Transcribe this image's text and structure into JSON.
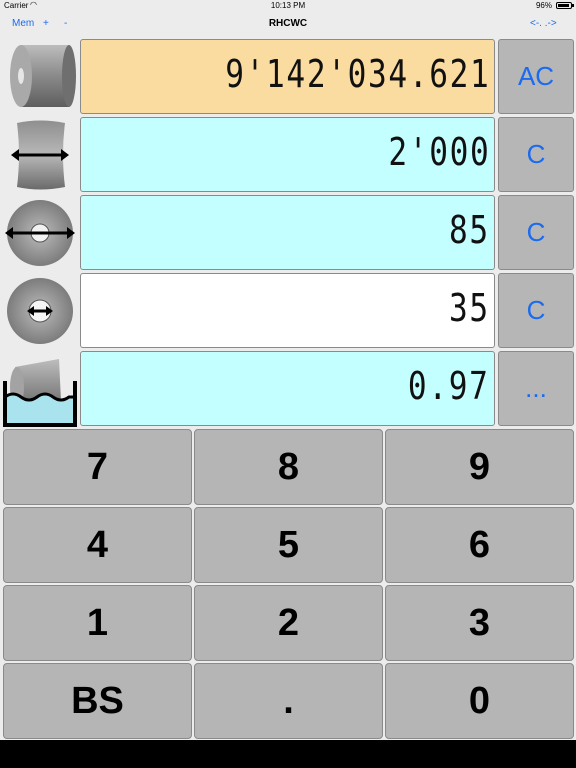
{
  "status_bar": {
    "carrier": "Carrier",
    "time": "10:13 PM",
    "battery": "96%"
  },
  "nav": {
    "mem": "Mem",
    "plus": "+",
    "minus": "-",
    "title": "RHCWC",
    "arrows": "<-. .->"
  },
  "rows": [
    {
      "icon": "roll-side-icon",
      "value": "9'142'034.621",
      "button": "AC",
      "bg": "#fadba0"
    },
    {
      "icon": "roll-width-icon",
      "value": "2'000",
      "button": "C",
      "bg": "#c4ffff"
    },
    {
      "icon": "outer-diameter-icon",
      "value": "85",
      "button": "C",
      "bg": "#c4ffff"
    },
    {
      "icon": "core-diameter-icon",
      "value": "35",
      "button": "C",
      "bg": "#ffffff"
    },
    {
      "icon": "density-water-icon",
      "value": "0.97",
      "button": "...",
      "bg": "#c4ffff"
    }
  ],
  "keypad": [
    "7",
    "8",
    "9",
    "4",
    "5",
    "6",
    "1",
    "2",
    "3",
    "BS",
    ".",
    "0"
  ]
}
